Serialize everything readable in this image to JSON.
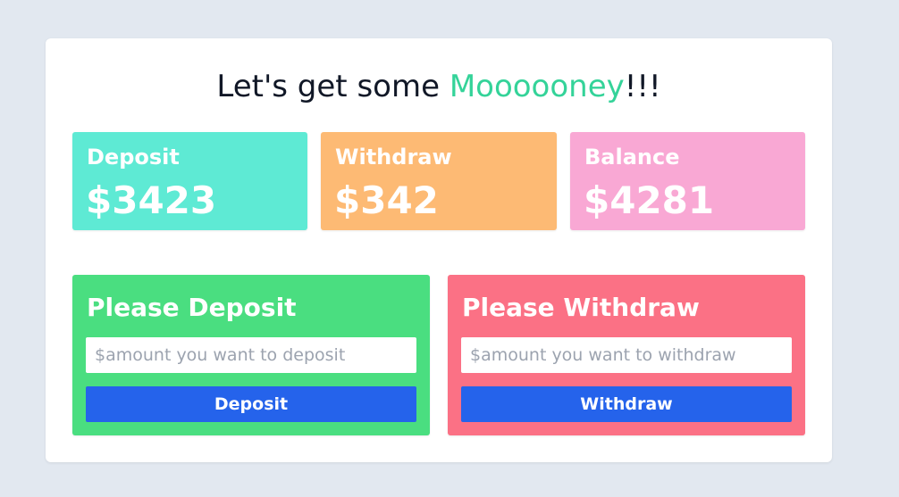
{
  "headline": {
    "prefix": "Let's get some ",
    "highlight": "Moooooney",
    "suffix": "!!!"
  },
  "stats": {
    "deposit": {
      "label": "Deposit",
      "value": "$3423"
    },
    "withdraw": {
      "label": "Withdraw",
      "value": "$342"
    },
    "balance": {
      "label": "Balance",
      "value": "$4281"
    }
  },
  "deposit_panel": {
    "title": "Please Deposit",
    "input_placeholder": "$amount you want to deposit",
    "input_value": "",
    "button_label": "Deposit"
  },
  "withdraw_panel": {
    "title": "Please Withdraw",
    "input_placeholder": "$amount you want to withdraw",
    "input_value": "",
    "button_label": "Withdraw"
  },
  "colors": {
    "page_background": "#e2e8f0",
    "highlight_text": "#34d399",
    "deposit_stat": "#5eead4",
    "withdraw_stat": "#fdba74",
    "balance_stat": "#f9a8d4",
    "deposit_panel": "#4ade80",
    "withdraw_panel": "#fb7185",
    "button": "#2563eb"
  }
}
